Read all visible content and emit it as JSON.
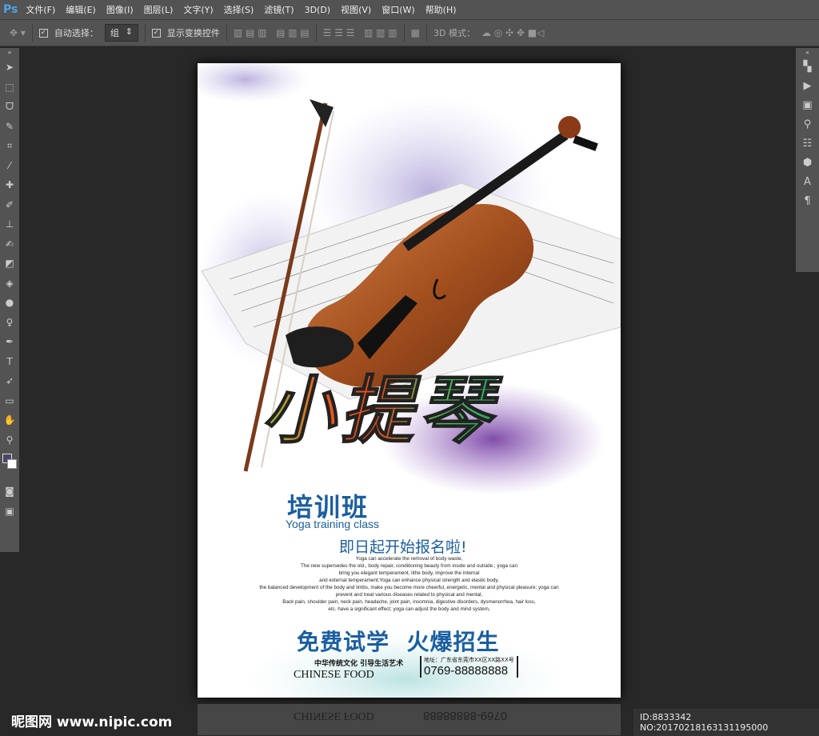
{
  "app": {
    "logo": "Ps"
  },
  "menu": [
    "文件(F)",
    "编辑(E)",
    "图像(I)",
    "图层(L)",
    "文字(Y)",
    "选择(S)",
    "滤镜(T)",
    "3D(D)",
    "视图(V)",
    "窗口(W)",
    "帮助(H)"
  ],
  "options": {
    "auto_select_label": "自动选择：",
    "auto_select_value": "组",
    "show_transform_label": "显示变换控件",
    "mode_3d_label": "3D 模式："
  },
  "poster": {
    "title": "小提琴",
    "subtitle_cn": "培训班",
    "subtitle_en": "Yoga training class",
    "enroll": "即日起开始报名啦!",
    "body_lines": [
      "Yoga can accelerate the removal of body waste,",
      "The new supersedes the old., body repair, conditioning beauty from inside and outside.; yoga can",
      "bring you elegant temperament, lithe body, improve the internal",
      "and external temperament;Yoga can enhance physical strength and elastic body,",
      "the balanced development of the body and limbs, make you become more cheerful, energetic, mental and physical pleasure; yoga can",
      "prevent and treat various diseases related to physical and mental,",
      "Back pain, shoulder pain, neck pain, headache, joint pain, insomnia, digestive disorders, dysmenorrhea, hair loss,",
      "etc. have a significant effect; yoga can adjust the body and mind system,"
    ],
    "slogan": "免费试学  火爆招生",
    "brand_cn": "中华传统文化 引导生活艺术",
    "brand_en": "CHINESE FOOD",
    "address": "地址：广东省东莞市XX区XX路XX号",
    "phone": "0769-88888888"
  },
  "watermark": "昵图网 www.nipic.com",
  "image_id": "ID:8833342 NO:20170218163131195000"
}
